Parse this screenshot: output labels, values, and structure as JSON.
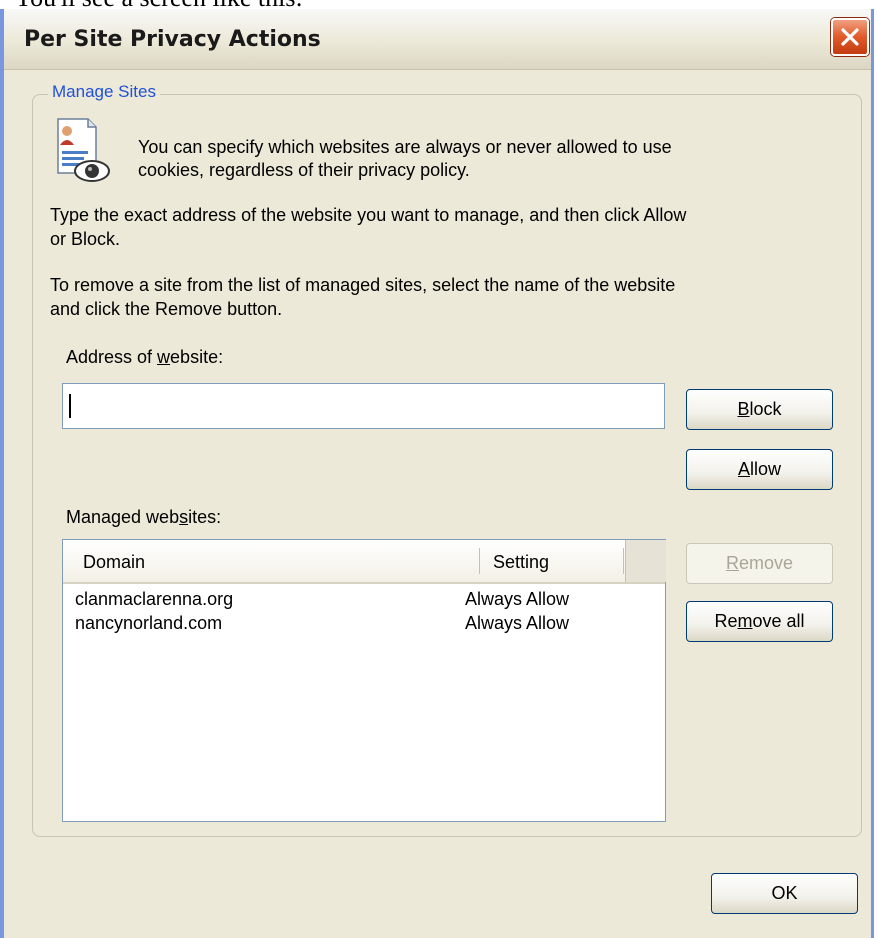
{
  "page_caption": "You'll see a screen like this:",
  "dialog": {
    "title": "Per Site Privacy Actions",
    "close_icon": "close-icon",
    "group": {
      "label": "Manage Sites",
      "icon": "document-eye-icon",
      "intro_line1": "You can specify which websites are always or never allowed to use",
      "intro_line2": "cookies, regardless of their privacy policy.",
      "type_line1": "Type the exact address of the website you want to manage, and then click Allow",
      "type_line2": "or Block.",
      "remove_line1": "To remove a site from the list of managed sites, select the name of the website",
      "remove_line2": "and click the Remove button.",
      "address_label_pre": "Address of ",
      "address_label_key": "w",
      "address_label_post": "ebsite:",
      "address_value": "",
      "block_pre": "",
      "block_key": "B",
      "block_post": "lock",
      "allow_pre": "",
      "allow_key": "A",
      "allow_post": "llow",
      "managed_label_pre": "Managed web",
      "managed_label_key": "s",
      "managed_label_post": "ites:",
      "columns": [
        "Domain",
        "Setting"
      ],
      "rows": [
        {
          "domain": "clanmaclarenna.org",
          "setting": "Always Allow"
        },
        {
          "domain": "nancynorland.com",
          "setting": "Always Allow"
        }
      ],
      "remove_pre": "",
      "remove_key": "R",
      "remove_post": "emove",
      "remove_all_pre": "Re",
      "remove_all_key": "m",
      "remove_all_post": "ove all"
    },
    "ok_label": "OK"
  }
}
